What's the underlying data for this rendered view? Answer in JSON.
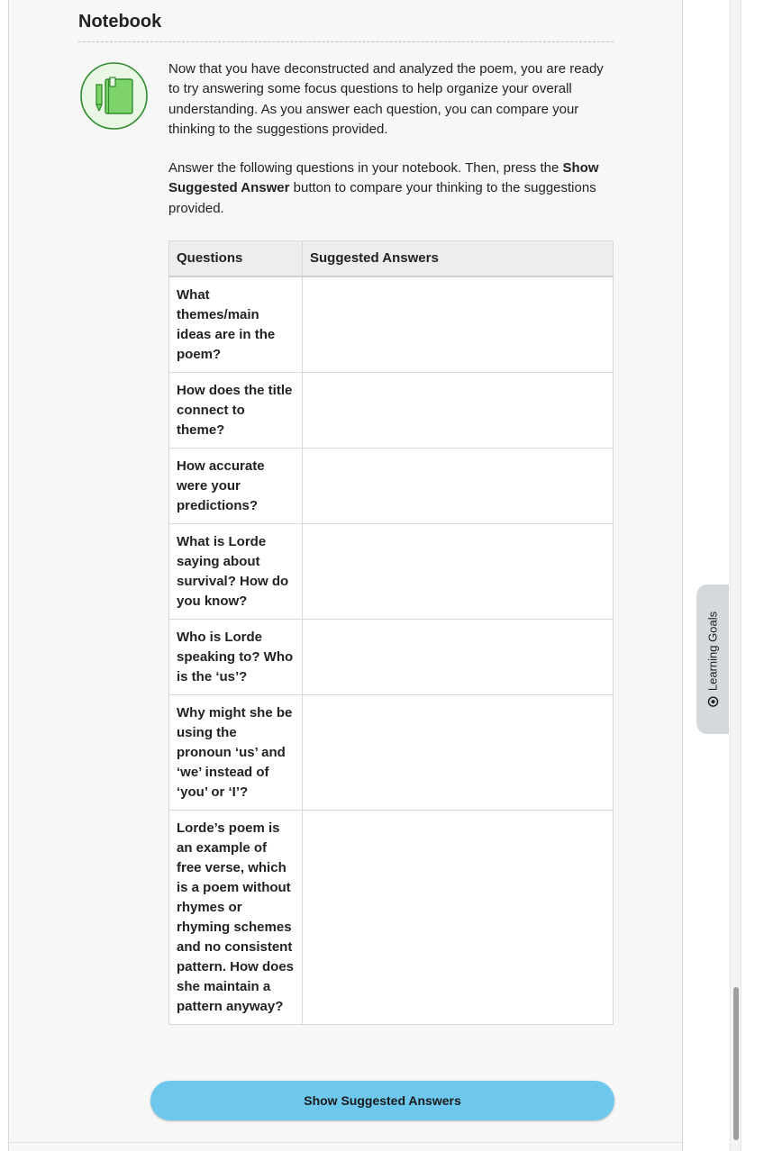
{
  "section": {
    "title": "Notebook",
    "icon": "notebook-pencil-icon"
  },
  "intro": {
    "paragraph1": "Now that you have deconstructed and analyzed the poem, you are ready to try answering some focus questions to help organize your overall understanding. As you answer each question, you can compare your thinking to the suggestions provided.",
    "paragraph2_before": "Answer the following questions in your notebook. Then, press the ",
    "paragraph2_bold": "Show Suggested Answer",
    "paragraph2_after": " button to compare your thinking to the suggestions provided."
  },
  "table": {
    "headers": {
      "questions": "Questions",
      "answers": "Suggested Answers"
    },
    "rows": [
      {
        "question": "What themes/main ideas are in the poem?",
        "answer": ""
      },
      {
        "question": "How does the title connect to theme?",
        "answer": ""
      },
      {
        "question": "How accurate were your predictions?",
        "answer": ""
      },
      {
        "question": "What is Lorde saying about survival? How do you know?",
        "answer": ""
      },
      {
        "question": "Who is Lorde speaking to? Who is the ‘us’?",
        "answer": ""
      },
      {
        "question": "Why might she be using the pronoun ‘us’ and ‘we’ instead of ‘you’ or ‘I’?",
        "answer": ""
      },
      {
        "question": "Lorde’s poem is an example of free verse, which is a poem without rhymes or rhyming schemes and no consistent pattern. How does she maintain a pattern anyway?",
        "answer": ""
      }
    ]
  },
  "button": {
    "label": "Show Suggested Answers"
  },
  "side_tab": {
    "label": "Learning Goals",
    "icon": "target-icon"
  },
  "colors": {
    "button_bg": "#6ec8ee",
    "panel_bg": "#f6f7f6",
    "icon_green": "#7ed36b",
    "icon_stroke": "#2e8b2e",
    "table_header_bg": "#ebedee"
  }
}
